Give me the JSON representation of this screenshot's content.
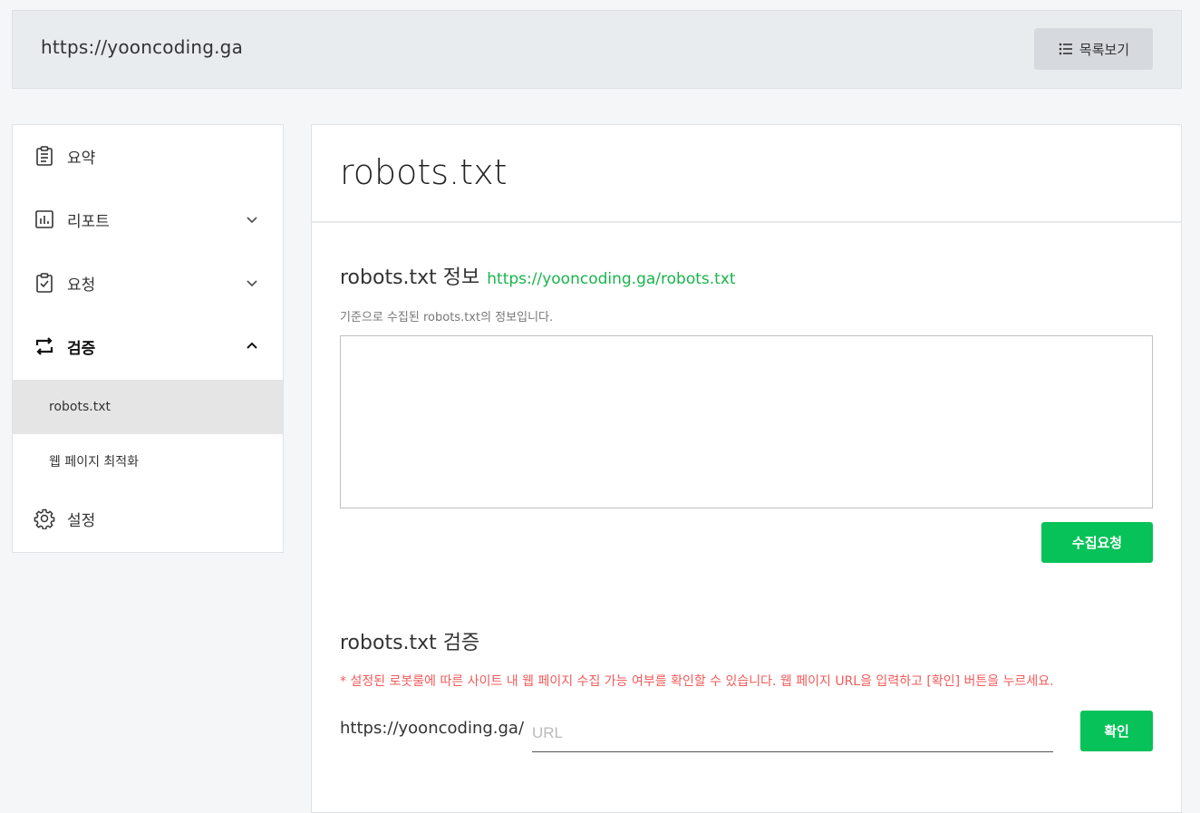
{
  "header": {
    "site_url": "https://yooncoding.ga",
    "list_button_label": "목록보기"
  },
  "sidebar": {
    "items": [
      {
        "label": "요약",
        "icon": "clipboard-list-icon"
      },
      {
        "label": "리포트",
        "icon": "bar-chart-icon",
        "expandable": true,
        "expanded": false
      },
      {
        "label": "요청",
        "icon": "clipboard-check-icon",
        "expandable": true,
        "expanded": false
      },
      {
        "label": "검증",
        "icon": "repeat-arrows-icon",
        "expandable": true,
        "expanded": true,
        "children": [
          {
            "label": "robots.txt",
            "active": true
          },
          {
            "label": "웹 페이지 최적화",
            "active": false
          }
        ]
      },
      {
        "label": "설정",
        "icon": "gear-icon"
      }
    ]
  },
  "main": {
    "page_title": "robots.txt",
    "info_section": {
      "title": "robots.txt 정보",
      "link": "https://yooncoding.ga/robots.txt",
      "description": "기준으로 수집된 robots.txt의 정보입니다.",
      "content": "",
      "collect_button": "수집요청"
    },
    "verify_section": {
      "title": "robots.txt 검증",
      "warning": "* 설정된 로봇룰에 따른 사이트 내 웹 페이지 수집 가능 여부를 확인할 수 있습니다. 웹 페이지 URL을 입력하고 [확인] 버튼을 누르세요.",
      "url_prefix": "https://yooncoding.ga/",
      "url_placeholder": "URL",
      "url_value": "",
      "confirm_button": "확인"
    }
  },
  "colors": {
    "accent_green": "#06c258",
    "link_green": "#19b44b",
    "warning_red": "#f25a5a"
  }
}
